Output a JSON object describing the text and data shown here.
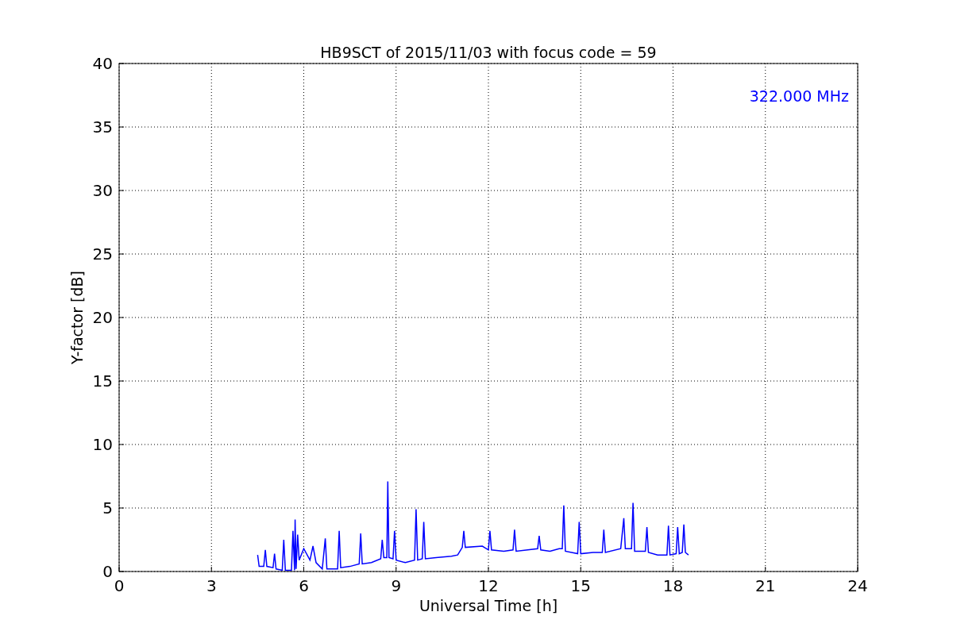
{
  "figure": {
    "chart_data": {
      "type": "line",
      "title": "HB9SCT of 2015/11/03 with focus code = 59",
      "xlabel": "Universal Time [h]",
      "ylabel": "Y-factor [dB]",
      "xlim": [
        0,
        24
      ],
      "ylim": [
        0,
        40
      ],
      "xticks": [
        0,
        3,
        6,
        9,
        12,
        15,
        18,
        21,
        24
      ],
      "yticks": [
        0,
        5,
        10,
        15,
        20,
        25,
        30,
        35,
        40
      ],
      "x": [
        4.5,
        4.55,
        4.7,
        4.75,
        4.8,
        5.0,
        5.05,
        5.1,
        5.3,
        5.35,
        5.4,
        5.6,
        5.65,
        5.7,
        5.72,
        5.75,
        5.8,
        5.85,
        6.0,
        6.2,
        6.3,
        6.4,
        6.6,
        6.7,
        6.75,
        7.1,
        7.15,
        7.2,
        7.5,
        7.8,
        7.85,
        7.9,
        8.2,
        8.5,
        8.55,
        8.6,
        8.7,
        8.73,
        8.77,
        8.9,
        8.95,
        9.0,
        9.3,
        9.6,
        9.65,
        9.7,
        9.85,
        9.9,
        9.95,
        10.3,
        10.8,
        11.0,
        11.15,
        11.2,
        11.25,
        11.8,
        12.0,
        12.05,
        12.1,
        12.5,
        12.8,
        12.85,
        12.9,
        13.6,
        13.65,
        13.7,
        14.0,
        14.3,
        14.4,
        14.45,
        14.5,
        14.9,
        14.95,
        15.0,
        15.4,
        15.7,
        15.75,
        15.8,
        16.3,
        16.4,
        16.45,
        16.65,
        16.7,
        16.75,
        17.1,
        17.15,
        17.2,
        17.5,
        17.8,
        17.85,
        17.9,
        18.1,
        18.15,
        18.2,
        18.3,
        18.35,
        18.4,
        18.5
      ],
      "grid": true,
      "series": [
        {
          "color": "#0000ff",
          "values": [
            1.3,
            0.4,
            0.4,
            1.7,
            0.4,
            0.3,
            1.4,
            0.2,
            0.1,
            2.5,
            0.1,
            0.1,
            3.2,
            0.1,
            4.1,
            0.2,
            2.9,
            0.9,
            1.8,
            0.9,
            2.0,
            0.7,
            0.2,
            2.6,
            0.2,
            0.2,
            3.2,
            0.3,
            0.4,
            0.6,
            3.0,
            0.6,
            0.7,
            1.0,
            2.5,
            1.1,
            1.1,
            7.1,
            1.1,
            1.0,
            3.2,
            0.9,
            0.7,
            0.9,
            4.9,
            0.9,
            1.0,
            3.9,
            1.0,
            1.1,
            1.2,
            1.3,
            1.9,
            3.2,
            1.9,
            2.0,
            1.7,
            3.2,
            1.7,
            1.6,
            1.7,
            3.3,
            1.6,
            1.8,
            2.8,
            1.7,
            1.6,
            1.8,
            1.8,
            5.2,
            1.6,
            1.4,
            3.9,
            1.4,
            1.5,
            1.5,
            3.3,
            1.5,
            1.8,
            4.2,
            1.8,
            1.8,
            5.4,
            1.6,
            1.6,
            3.5,
            1.5,
            1.3,
            1.3,
            3.6,
            1.3,
            1.4,
            3.5,
            1.4,
            1.5,
            3.7,
            1.5,
            1.3
          ]
        }
      ],
      "annotations": [
        {
          "text": "322.000 MHz"
        }
      ]
    }
  }
}
